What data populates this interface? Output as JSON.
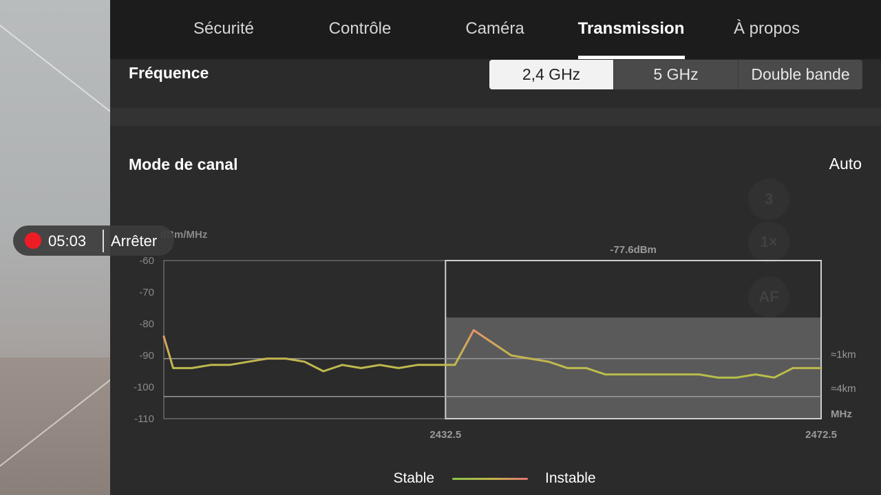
{
  "tabs": [
    {
      "label": "Sécurité",
      "active": false
    },
    {
      "label": "Contrôle",
      "active": false
    },
    {
      "label": "Caméra",
      "active": false
    },
    {
      "label": "Transmission",
      "active": true
    },
    {
      "label": "À propos",
      "active": false
    }
  ],
  "frequency": {
    "label": "Fréquence",
    "options": [
      "2,4 GHz",
      "5 GHz",
      "Double bande"
    ],
    "selected": "2,4 GHz"
  },
  "channel_mode": {
    "label": "Mode de canal",
    "value": "Auto"
  },
  "recording": {
    "time": "05:03",
    "stop_label": "Arrêter"
  },
  "ghost_buttons": [
    "3",
    "1×",
    "AF"
  ],
  "legend": {
    "stable": "Stable",
    "unstable": "Instable"
  },
  "colors": {
    "stable": "#8bc34a",
    "unstable": "#e57373",
    "signal": "#c4b54a",
    "record": "#ee1c25"
  },
  "chart_data": {
    "type": "line",
    "ylabel": "dBm/MHz",
    "xlabel": "MHz",
    "yticks": [
      -60,
      -70,
      -80,
      -90,
      -100,
      -110
    ],
    "ylim": [
      -110,
      -60
    ],
    "xticks": [
      2432.5,
      2472.5
    ],
    "xlim": [
      2402.5,
      2472.5
    ],
    "selected_channel": {
      "from": 2432.5,
      "to": 2472.5,
      "label": "-77.6dBm",
      "level": -78
    },
    "reference_lines": [
      {
        "value": -91,
        "label": "≈1km"
      },
      {
        "value": -103,
        "label": "≈4km"
      }
    ],
    "series": [
      {
        "x": [
          2402.5,
          2403.5,
          2405.5,
          2407.5,
          2409.5,
          2411.5,
          2413.5,
          2415.5,
          2417.5,
          2419.5,
          2421.5,
          2423.5,
          2425.5,
          2427.5,
          2429.5,
          2431.5,
          2433.5,
          2435.5,
          2437.5,
          2439.5,
          2441.5,
          2443.5,
          2445.5,
          2447.5,
          2449.5,
          2451.5,
          2453.5,
          2455.5,
          2457.5,
          2459.5,
          2461.5,
          2463.5,
          2465.5,
          2467.5,
          2469.5,
          2471.5,
          2472.5
        ],
        "y": [
          -84,
          -94,
          -94,
          -93,
          -93,
          -92,
          -91,
          -91,
          -92,
          -95,
          -93,
          -94,
          -93,
          -94,
          -93,
          -93,
          -93,
          -82,
          -86,
          -90,
          -91,
          -92,
          -94,
          -94,
          -96,
          -96,
          -96,
          -96,
          -96,
          -96,
          -97,
          -97,
          -96,
          -97,
          -94,
          -94,
          -94
        ]
      }
    ]
  }
}
